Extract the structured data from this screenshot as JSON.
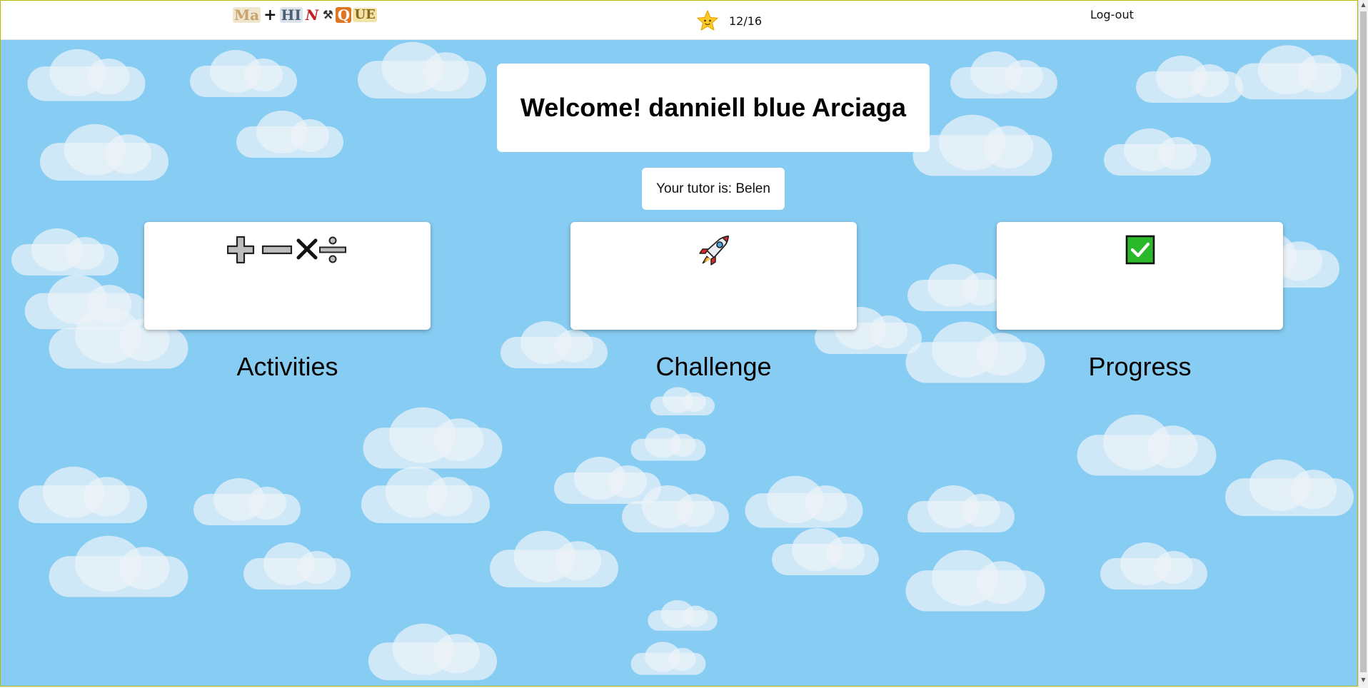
{
  "header": {
    "logo_letters": [
      "Ma",
      "+",
      "HI",
      "N",
      "⚒",
      "Q",
      "UE"
    ],
    "star_icon": "star-icon",
    "score": "12/16",
    "logout_label": "Log-out"
  },
  "welcome": {
    "title": "Welcome! danniell blue Arciaga",
    "tutor": "Your tutor is: Belen"
  },
  "cards": [
    {
      "label": "Activities",
      "icon": "math-operations-icon"
    },
    {
      "label": "Challenge",
      "icon": "rocket-icon"
    },
    {
      "label": "Progress",
      "icon": "check-box-icon"
    }
  ],
  "colors": {
    "sky": "#87ccf2",
    "check_green": "#2bb82b",
    "star_yellow": "#ffc928"
  }
}
